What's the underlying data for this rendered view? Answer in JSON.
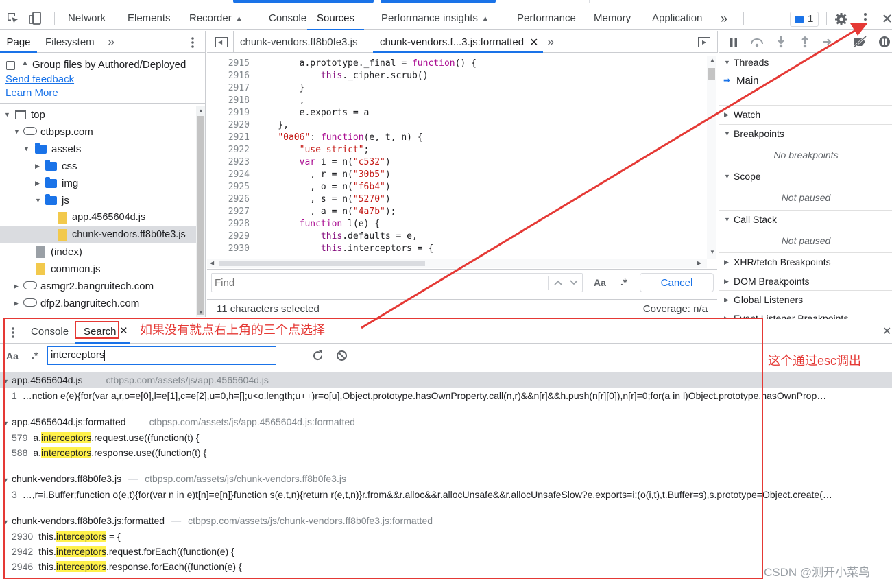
{
  "toolbar": {
    "tabs": [
      "Network",
      "Elements",
      "Recorder",
      "Console",
      "Sources",
      "Performance insights",
      "Performance",
      "Memory",
      "Application"
    ],
    "more": "»",
    "issues_count": "1"
  },
  "navigator": {
    "tabs": [
      "Page",
      "Filesystem"
    ],
    "more": "»",
    "group_label": "Group files by Authored/Deployed",
    "send_feedback": "Send feedback",
    "learn_more": "Learn More",
    "tree": [
      "top",
      "ctbpsp.com",
      "assets",
      "css",
      "img",
      "js",
      "app.4565604d.js",
      "chunk-vendors.ff8b0fe3.js",
      "(index)",
      "common.js",
      "asmgr2.bangruitech.com",
      "dfp2.bangruitech.com"
    ]
  },
  "editor": {
    "tabs": [
      "chunk-vendors.ff8b0fe3.js",
      "chunk-vendors.f...3.js:formatted"
    ],
    "more": "»",
    "lines": [
      {
        "n": "2915",
        "t": "        a.prototype._final = function() {"
      },
      {
        "n": "2916",
        "t": "            this._cipher.scrub()"
      },
      {
        "n": "2917",
        "t": "        }"
      },
      {
        "n": "2918",
        "t": "        ,"
      },
      {
        "n": "2919",
        "t": "        e.exports = a"
      },
      {
        "n": "2920",
        "t": "    },"
      },
      {
        "n": "2921",
        "t": "    \"0a06\": function(e, t, n) {"
      },
      {
        "n": "2922",
        "t": "        \"use strict\";"
      },
      {
        "n": "2923",
        "t": "        var i = n(\"c532\")"
      },
      {
        "n": "2924",
        "t": "          , r = n(\"30b5\")"
      },
      {
        "n": "2925",
        "t": "          , o = n(\"f6b4\")"
      },
      {
        "n": "2926",
        "t": "          , s = n(\"5270\")"
      },
      {
        "n": "2927",
        "t": "          , a = n(\"4a7b\");"
      },
      {
        "n": "2928",
        "t": "        function l(e) {"
      },
      {
        "n": "2929",
        "t": "            this.defaults = e,"
      },
      {
        "n": "2930",
        "t": "            this.interceptors = {"
      }
    ],
    "find_placeholder": "Find",
    "find_aa": "Aa",
    "find_regex": ".*",
    "cancel": "Cancel",
    "status_left": "11 characters selected",
    "status_right": "Coverage: n/a"
  },
  "debugger": {
    "threads": "Threads",
    "main": "Main",
    "watch": "Watch",
    "breakpoints": "Breakpoints",
    "no_breakpoints": "No breakpoints",
    "scope": "Scope",
    "not_paused": "Not paused",
    "call_stack": "Call Stack",
    "not_paused2": "Not paused",
    "xhr": "XHR/fetch Breakpoints",
    "dom": "DOM Breakpoints",
    "global": "Global Listeners",
    "event": "Event Listener Breakpoints"
  },
  "drawer": {
    "tabs": [
      "Console",
      "Search"
    ],
    "annotation_top": "如果没有就点右上角的三个点选择",
    "annotation_right": "这个通过esc调出",
    "search_aa": "Aa",
    "search_regex": ".*",
    "search_value": "interceptors",
    "results": [
      {
        "file": "app.4565604d.js",
        "path": "ctbpsp.com/assets/js/app.4565604d.js",
        "lines": [
          {
            "n": "1",
            "pre": "…nction e(e){for(var a,r,o=e[0],l=e[1],c=e[2],u=0,h=[];u<o.length;u++)r=o[u],Object.prototype.hasOwnProperty.call(n,r)&&n[r]&&h.push(n[r][0]),n[r]=0;for(a in l)Object.prototype.hasOwnProp…",
            "hl": "",
            "post": ""
          }
        ]
      },
      {
        "file": "app.4565604d.js:formatted",
        "path": "ctbpsp.com/assets/js/app.4565604d.js:formatted",
        "lines": [
          {
            "n": "579",
            "pre": "a.",
            "hl": "interceptors",
            "post": ".request.use((function(t) {"
          },
          {
            "n": "588",
            "pre": "a.",
            "hl": "interceptors",
            "post": ".response.use((function(t) {"
          }
        ]
      },
      {
        "file": "chunk-vendors.ff8b0fe3.js",
        "path": "ctbpsp.com/assets/js/chunk-vendors.ff8b0fe3.js",
        "lines": [
          {
            "n": "3",
            "pre": "…,r=i.Buffer;function o(e,t){for(var n in e)t[n]=e[n]}function s(e,t,n){return r(e,t,n)}r.from&&r.alloc&&r.allocUnsafe&&r.allocUnsafeSlow?e.exports=i:(o(i,t),t.Buffer=s),s.prototype=Object.create(…",
            "hl": "",
            "post": ""
          }
        ]
      },
      {
        "file": "chunk-vendors.ff8b0fe3.js:formatted",
        "path": "ctbpsp.com/assets/js/chunk-vendors.ff8b0fe3.js:formatted",
        "lines": [
          {
            "n": "2930",
            "pre": "this.",
            "hl": "interceptors",
            "post": " = {"
          },
          {
            "n": "2942",
            "pre": "this.",
            "hl": "interceptors",
            "post": ".request.forEach((function(e) {"
          },
          {
            "n": "2946",
            "pre": "this.",
            "hl": "interceptors",
            "post": ".response.forEach((function(e) {"
          }
        ]
      }
    ]
  },
  "watermark": "CSDN @测开小菜鸟",
  "colors": {
    "accent": "#1a73e8",
    "annotation": "#e53935",
    "highlight": "#fff14a"
  }
}
